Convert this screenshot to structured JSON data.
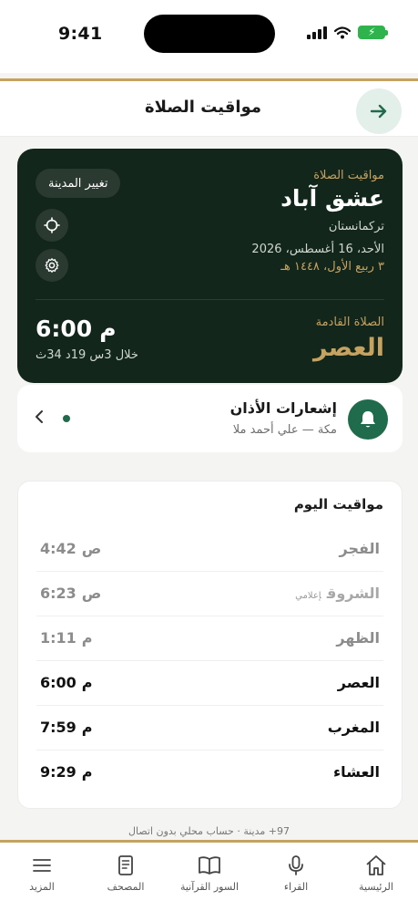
{
  "status": {
    "time": "9:41"
  },
  "header": {
    "title": "مواقيت الصلاة"
  },
  "hero": {
    "label": "مواقيت الصلاة",
    "city": "عشق آباد",
    "country": "تركمانستان",
    "date": "الأحد، 16 أغسطس، 2026",
    "hijri": "٣ ربيع الأول، ١٤٤٨ هـ",
    "change_city": "تغيير المدينة",
    "next_label": "الصلاة القادمة",
    "next_name": "العصر",
    "next_time": "6:00",
    "next_period": "م",
    "remaining": "خلال 3س 19د 34ث"
  },
  "adhan": {
    "title": "إشعارات الأذان",
    "subtitle": "مكة — علي أحمد ملا"
  },
  "today": {
    "title": "مواقيت اليوم",
    "rows": [
      {
        "name": "الفجر",
        "time": "4:42",
        "period": "ص",
        "tag": ""
      },
      {
        "name": "الشروق",
        "time": "6:23",
        "period": "ص",
        "tag": "إعلامي"
      },
      {
        "name": "الظهر",
        "time": "1:11",
        "period": "م",
        "tag": ""
      },
      {
        "name": "العصر",
        "time": "6:00",
        "period": "م",
        "tag": ""
      },
      {
        "name": "المغرب",
        "time": "7:59",
        "period": "م",
        "tag": ""
      },
      {
        "name": "العشاء",
        "time": "9:29",
        "period": "م",
        "tag": ""
      }
    ]
  },
  "footer_note": "97+ مدينة · حساب محلي بدون اتصال",
  "tabs": [
    {
      "label": "الرئيسية",
      "icon": "home-icon"
    },
    {
      "label": "القراء",
      "icon": "microphone-icon"
    },
    {
      "label": "السور القرآنية",
      "icon": "book-icon"
    },
    {
      "label": "المصحف",
      "icon": "mushaf-icon"
    },
    {
      "label": "المزيد",
      "icon": "menu-icon"
    }
  ],
  "colors": {
    "primary": "#1f6b4c",
    "gold": "#c6a260",
    "hero_bg": "#13261b"
  }
}
